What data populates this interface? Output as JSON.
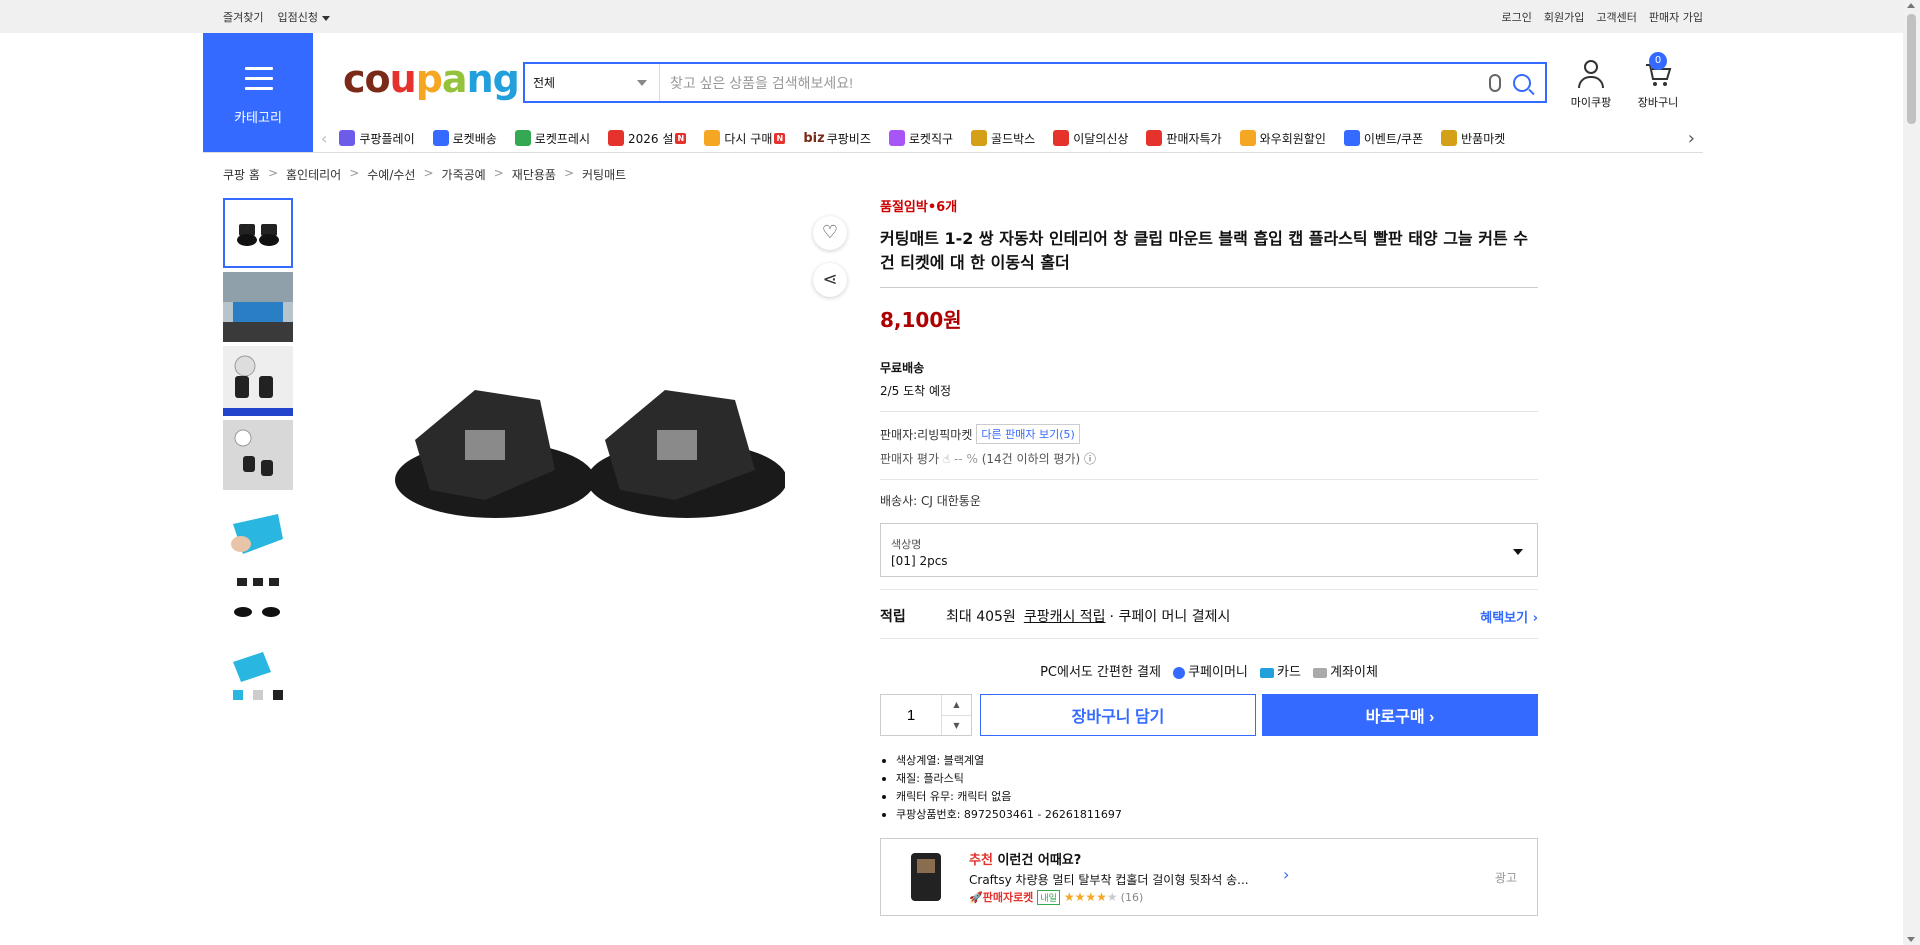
{
  "topbar": {
    "left": [
      "즐겨찾기",
      "입점신청"
    ],
    "right": [
      "로그인",
      "회원가입",
      "고객센터",
      "판매자 가입"
    ]
  },
  "header": {
    "category_label": "카테고리",
    "logo_letters": [
      "c",
      "o",
      "u",
      "p",
      "a",
      "n",
      "g"
    ],
    "search": {
      "select_value": "전체",
      "placeholder": "찾고 싶은 상품을 검색해보세요!"
    },
    "my_label": "마이쿠팡",
    "cart_label": "장바구니",
    "cart_count": "0"
  },
  "catnav": [
    {
      "label": "쿠팡플레이",
      "icon": "play-icon",
      "color": "#6c5ce7"
    },
    {
      "label": "로켓배송",
      "icon": "rocket-icon",
      "color": "#346aff"
    },
    {
      "label": "로켓프레시",
      "icon": "rocket-fresh-icon",
      "color": "#34a853"
    },
    {
      "label": "2026 설",
      "icon": "gift-icon",
      "color": "#e5322d",
      "new": true
    },
    {
      "label": "다시 구매",
      "icon": "repeat-icon",
      "color": "#f5a623",
      "new": true
    },
    {
      "label": "쿠팡비즈",
      "icon": "biz-icon",
      "color": "#7b2a19",
      "prefix": "biz"
    },
    {
      "label": "로켓직구",
      "icon": "globe-icon",
      "color": "#a855f7"
    },
    {
      "label": "골드박스",
      "icon": "gold-box-icon",
      "color": "#d4a017"
    },
    {
      "label": "이달의신상",
      "icon": "new-item-icon",
      "color": "#e5322d"
    },
    {
      "label": "판매자특가",
      "icon": "percent-icon",
      "color": "#e5322d"
    },
    {
      "label": "와우회원할인",
      "icon": "wow-icon",
      "color": "#f5a623"
    },
    {
      "label": "이벤트/쿠폰",
      "icon": "coupon-icon",
      "color": "#346aff"
    },
    {
      "label": "반품마켓",
      "icon": "return-market-icon",
      "color": "#d4a017"
    }
  ],
  "breadcrumb": [
    "쿠팡 홈",
    "홈인테리어",
    "수예/수선",
    "가죽공예",
    "재단용품",
    "커팅매트"
  ],
  "product": {
    "stock": "품절임박•6개",
    "title": "커팅매트 1-2 쌍 자동차 인테리어 창 클립 마운트 블랙 흡입 캡 플라스틱 빨판 태양 그늘 커튼 수건 티켓에 대 한 이동식 홀더",
    "price": "8,100원",
    "shipping_title": "무료배송",
    "shipping_date": "2/5 도착 예정",
    "seller_prefix": "판매자:",
    "seller_name": "리빙픽마켓",
    "other_sellers": "다른 판매자 보기(5)",
    "rating_label": "판매자 평가",
    "rating_value": "-- %",
    "rating_note": "(14건 이하의 평가)",
    "delivery_company": "배송사:  CJ 대한통운",
    "option_label": "색상명",
    "option_value": "[01] 2pcs",
    "reward_title": "적립",
    "reward_text": "최대 405원",
    "reward_link": "쿠팡캐시 적립",
    "reward_suffix": "· 쿠페이 머니 결제시",
    "reward_more": "혜택보기",
    "pc_pay": "PC에서도 간편한 결제",
    "pay_methods": [
      "쿠페이머니",
      "카드",
      "계좌이체"
    ],
    "quantity": "1",
    "cart_button": "장바구니 담기",
    "buy_button": "바로구매",
    "attributes": [
      "색상계열: 블랙계열",
      "재질: 플라스틱",
      "캐릭터 유무: 캐릭터 없음",
      "쿠팡상품번호: 8972503461 - 26261811697"
    ]
  },
  "recommend": {
    "title_red": "추천",
    "title": "이런건 어때요?",
    "name": "Craftsy 차량용 멀티 탈부착 컵홀더 걸이형 뒷좌석 송...",
    "badge": "판매자로켓",
    "tomorrow": "내일",
    "rating": 4,
    "review_count": "(16)",
    "ad": "광고"
  }
}
